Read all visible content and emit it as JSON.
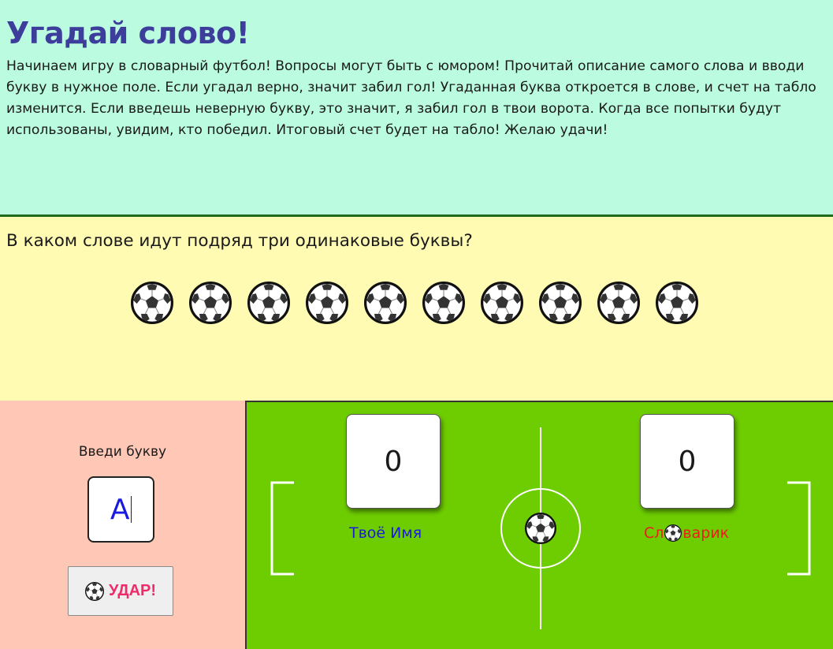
{
  "intro": {
    "title": "Угадай слово!",
    "description": "Начинаем игру в словарный футбол! Вопросы могут быть с юмором! Прочитай описание самого слова и вводи букву в нужное поле. Если угадал верно, значит забил гол! Угаданная буква откроется в слове, и счет на табло изменится. Если введешь неверную букву, это значит, я забил гол в твои ворота. Когда все попытки будут использованы, увидим, кто победил. Итоговый счет будет на табло! Желаю удачи!"
  },
  "question": {
    "text": "В каком слове идут подряд три одинаковые буквы?",
    "hidden_letter_count": 10,
    "hidden_letter_icon": "soccer-ball-icon"
  },
  "input": {
    "label": "Введи букву",
    "value": "А",
    "kick_button_label": "УДАР!",
    "kick_button_icon": "soccer-ball-icon"
  },
  "scoreboard": {
    "player_score": "0",
    "player_name": "Твоё Имя",
    "opponent_score": "0",
    "opponent_name_start": "Сл",
    "opponent_name_end": "варик",
    "opponent_name_icon": "soccer-ball-icon"
  },
  "colors": {
    "intro_bg": "#bbfbe0",
    "title": "#3d3d9b",
    "question_bg": "#fffbb2",
    "input_panel_bg": "#ffc8b6",
    "field_bg": "#6ecd00",
    "kick_label": "#ef2b6a",
    "player_name": "#1a1ae0",
    "opponent_name": "#ee1c1c"
  }
}
